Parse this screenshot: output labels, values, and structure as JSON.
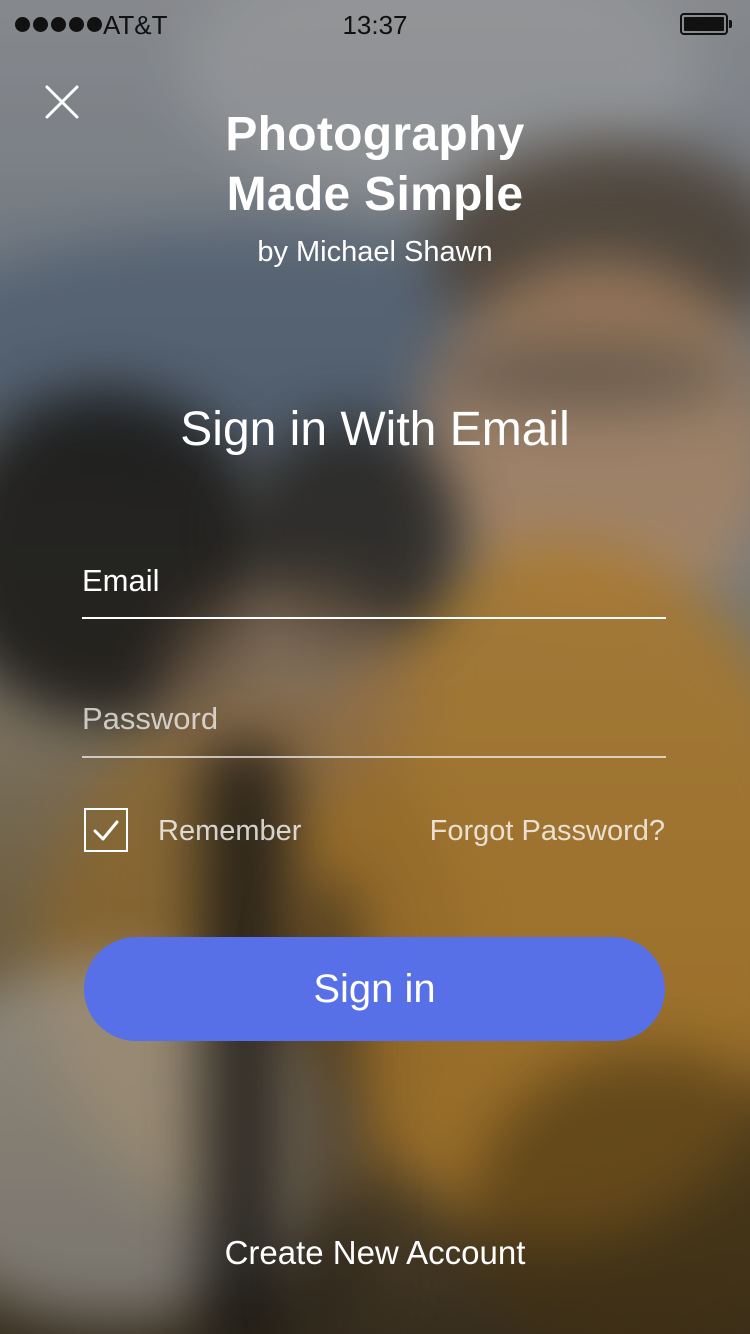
{
  "status_bar": {
    "carrier": "AT&T",
    "time": "13:37",
    "signal_bars": 5,
    "battery_level": 1.0
  },
  "close": {
    "icon": "close-icon"
  },
  "app": {
    "title_line1": "Photography",
    "title_line2": "Made Simple",
    "author": "by Michael Shawn"
  },
  "form": {
    "heading": "Sign in With Email",
    "email_placeholder": "Email",
    "email_value": "",
    "password_placeholder": "Password",
    "password_value": "",
    "remember_label": "Remember",
    "remember_checked": true,
    "forgot_password_label": "Forgot Password?",
    "sign_in_label": "Sign in",
    "sign_in_color": "#5770e8"
  },
  "footer": {
    "create_account_label": "Create New Account"
  }
}
